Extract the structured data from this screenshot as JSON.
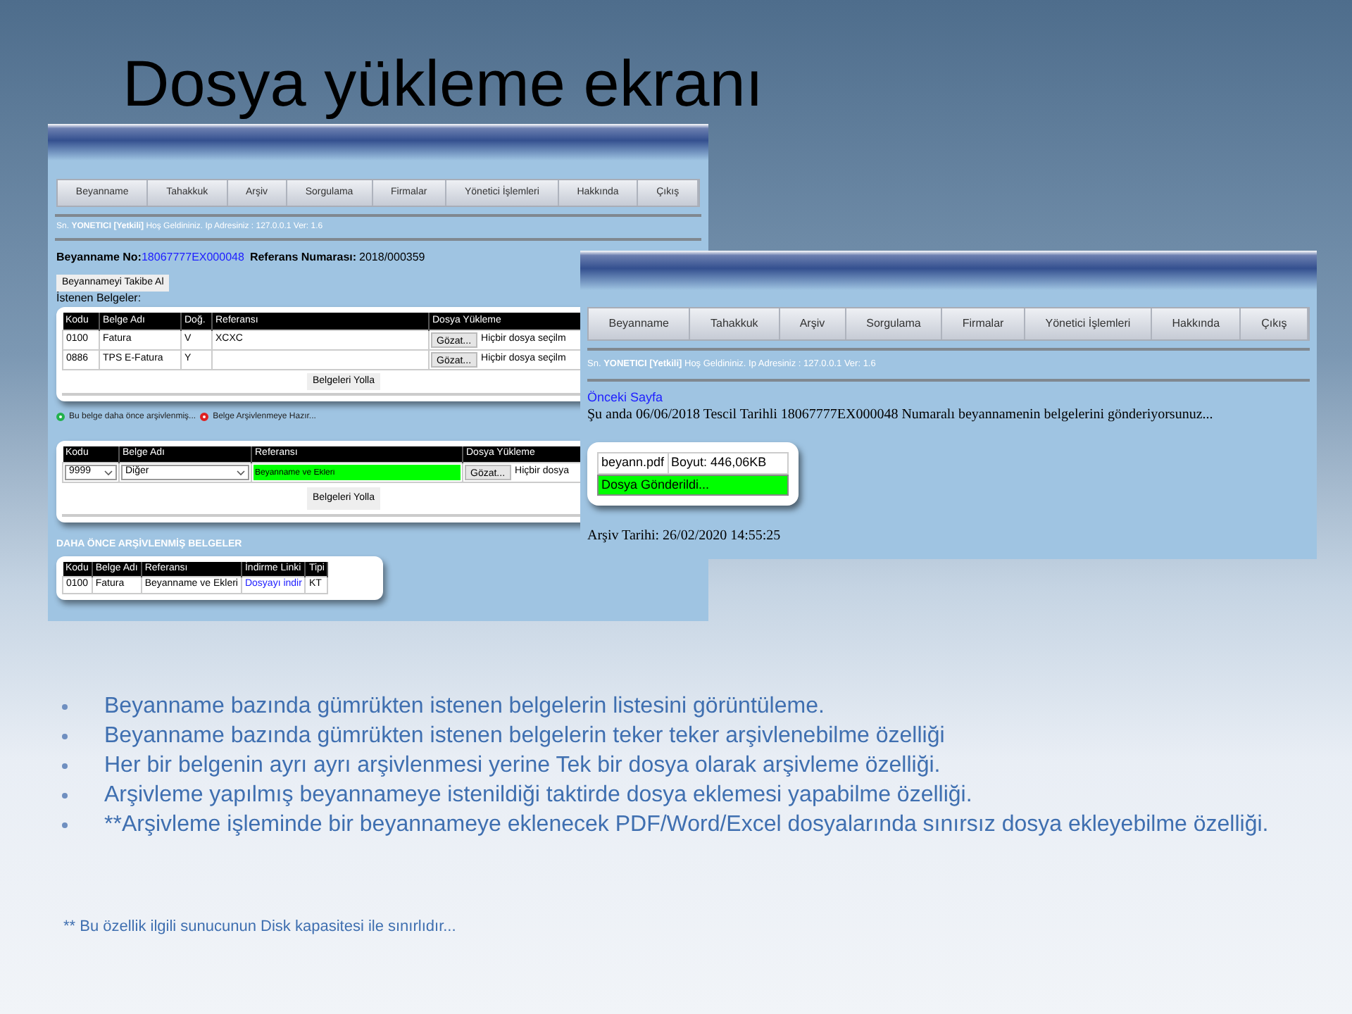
{
  "title": "Dosya yükleme ekranı",
  "screenshot_upload": {
    "nav": [
      "Beyanname",
      "Tahakkuk",
      "Arşiv",
      "Sorgulama",
      "Firmalar",
      "Yönetici İşlemleri",
      "Hakkında",
      "Çıkış"
    ],
    "welcome": "Sn. **YONETICI [Yetkili]** Hoş Geldininiz. Ip Adresiniz : 127.0.0.1 Ver: 1.6",
    "declaration_label": "Beyanname No:",
    "declaration_no": "18067777EX000048",
    "reference_label": "Referans Numarası:",
    "reference_no": "2018/000359",
    "follow_button": "Beyannameyi Takibe Al",
    "requested_label": "İstenen Belgeler:",
    "requested_table": {
      "columns": [
        "Kodu",
        "Belge Adı",
        "Doğ.",
        "Referansı",
        "Dosya Yükleme"
      ],
      "rows": [
        {
          "cells": [
            "0100",
            "Fatura",
            "V",
            "XCXC"
          ],
          "browse": "Gözat...",
          "file_status": "Hiçbir dosya seçilm"
        },
        {
          "cells": [
            "0886",
            "TPS E-Fatura",
            "Y",
            ""
          ],
          "browse": "Gözat...",
          "file_status": "Hiçbir dosya seçilm"
        }
      ],
      "submit": "Belgeleri Yolla"
    },
    "legend": [
      {
        "text": "Bu belge daha önce arşivlenmiş...",
        "color": "#22b14c"
      },
      {
        "text": "Belge Arşivlenmeye Hazır...",
        "color": "#e02020"
      }
    ],
    "other_table": {
      "columns": [
        "Kodu",
        "Belge Adı",
        "Referansı",
        "Dosya Yükleme"
      ],
      "code": "9999",
      "name": "Diğer",
      "reference": "Beyanname ve Ekleri",
      "browse": "Gözat...",
      "file_status": "Hiçbir dosya",
      "submit": "Belgeleri Yolla"
    },
    "archived_heading": "DAHA ÖNCE ARŞİVLENMİŞ BELGELER",
    "archived_table": {
      "columns": [
        "Kodu",
        "Belge Adı",
        "Referansı",
        "İndirme Linki",
        "Tipi"
      ],
      "rows": [
        {
          "code": "0100",
          "name": "Fatura",
          "reference": "Beyanname ve Ekleri",
          "link": "Dosyayı indir",
          "type": "KT"
        }
      ]
    }
  },
  "screenshot_sent": {
    "nav": [
      "Beyanname",
      "Tahakkuk",
      "Arşiv",
      "Sorgulama",
      "Firmalar",
      "Yönetici İşlemleri",
      "Hakkında",
      "Çıkış"
    ],
    "welcome": "Sn. **YONETICI [Yetkili]** Hoş Geldininiz. Ip Adresiniz : 127.0.0.1 Ver: 1.6",
    "back_link": "Önceki Sayfa",
    "message": "Şu anda 06/06/2018 Tescil Tarihli 18067777EX000048 Numaralı beyannamenin belgelerini gönderiyorsunuz...",
    "file_name": "beyann.pdf",
    "file_size": "Boyut: 446,06KB",
    "file_status": "Dosya Gönderildi...",
    "archive_date": "Arşiv Tarihi: 26/02/2020 14:55:25"
  },
  "bullets": [
    "Beyanname bazında gümrükten istenen belgelerin listesini görüntüleme.",
    "Beyanname bazında gümrükten istenen belgelerin teker teker arşivlenebilme özelliği",
    "Her bir belgenin ayrı ayrı arşivlenmesi yerine Tek bir dosya olarak arşivleme özelliği.",
    "Arşivleme yapılmış beyannameye istenildiği taktirde dosya eklemesi yapabilme özelliği.",
    "**Arşivleme işleminde bir beyannameye eklenecek PDF/Word/Excel dosyalarında sınırsız dosya ekleyebilme özelliği."
  ],
  "footnote": "** Bu özellik ilgili sunucunun Disk kapasitesi ile sınırlıdır..."
}
